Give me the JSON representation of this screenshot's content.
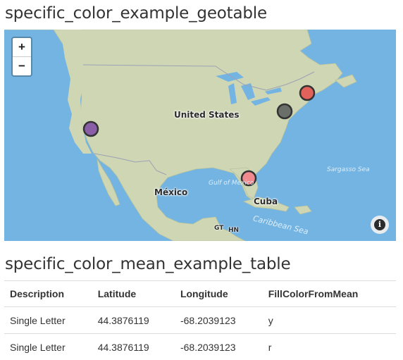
{
  "section1": {
    "title": "specific_color_example_geotable"
  },
  "map": {
    "zoom_in": "+",
    "zoom_out": "−",
    "info": "i",
    "labels": {
      "united_states": "United States",
      "mexico": "México",
      "cuba": "Cuba",
      "gulf": "Gulf of Mexico",
      "sargasso": "Sargasso Sea",
      "caribbean": "Caribbean Sea",
      "gt": "GT",
      "hn": "HN"
    },
    "colors": {
      "water": "#74b4e2",
      "land": "#cfd6b4",
      "marker_border": "#333333",
      "marker_purple": "#8a5fa8",
      "marker_red": "#e0625a",
      "marker_gray": "#6a6f69",
      "marker_pink": "#f08a8f"
    }
  },
  "section2": {
    "title": "specific_color_mean_example_table"
  },
  "table": {
    "headers": [
      "Description",
      "Latitude",
      "Longitude",
      "FillColorFromMean"
    ],
    "rows": [
      [
        "Single Letter",
        "44.3876119",
        "-68.2039123",
        "y"
      ],
      [
        "Single Letter",
        "44.3876119",
        "-68.2039123",
        "r"
      ]
    ]
  }
}
